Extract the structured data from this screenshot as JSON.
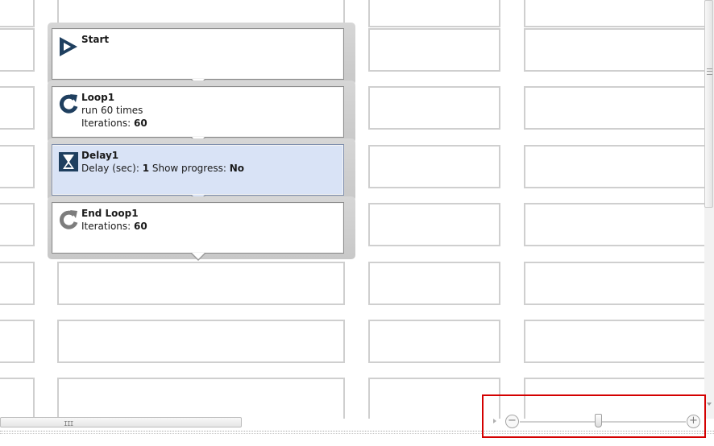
{
  "workflow": {
    "steps": [
      {
        "title": "Start",
        "lines": [],
        "icon": "play-triangle-icon",
        "selected": false
      },
      {
        "title": "Loop1",
        "lines": [
          {
            "parts": [
              {
                "text": "run 60 times",
                "bold": false
              }
            ]
          },
          {
            "parts": [
              {
                "text": "Iterations: ",
                "bold": false
              },
              {
                "text": "60",
                "bold": true
              }
            ]
          }
        ],
        "icon": "loop-arrow-icon",
        "selected": false
      },
      {
        "title": "Delay1",
        "lines": [
          {
            "parts": [
              {
                "text": "Delay (sec): ",
                "bold": false
              },
              {
                "text": "1",
                "bold": true
              },
              {
                "text": " Show progress: ",
                "bold": false
              },
              {
                "text": "No",
                "bold": true
              }
            ]
          }
        ],
        "icon": "hourglass-icon",
        "selected": true
      },
      {
        "title": "End Loop1",
        "lines": [
          {
            "parts": [
              {
                "text": "Iterations: ",
                "bold": false
              },
              {
                "text": "60",
                "bold": true
              }
            ]
          }
        ],
        "icon": "end-loop-arrow-icon",
        "selected": false
      }
    ]
  },
  "scrollbar": {
    "grip": "III"
  },
  "zoom": {
    "minus": "−",
    "plus": "+",
    "level": 0.47
  },
  "colors": {
    "selected_step": "#d9e3f6",
    "icon_blue": "#1f3f5f",
    "highlight_box": "#d40000"
  }
}
